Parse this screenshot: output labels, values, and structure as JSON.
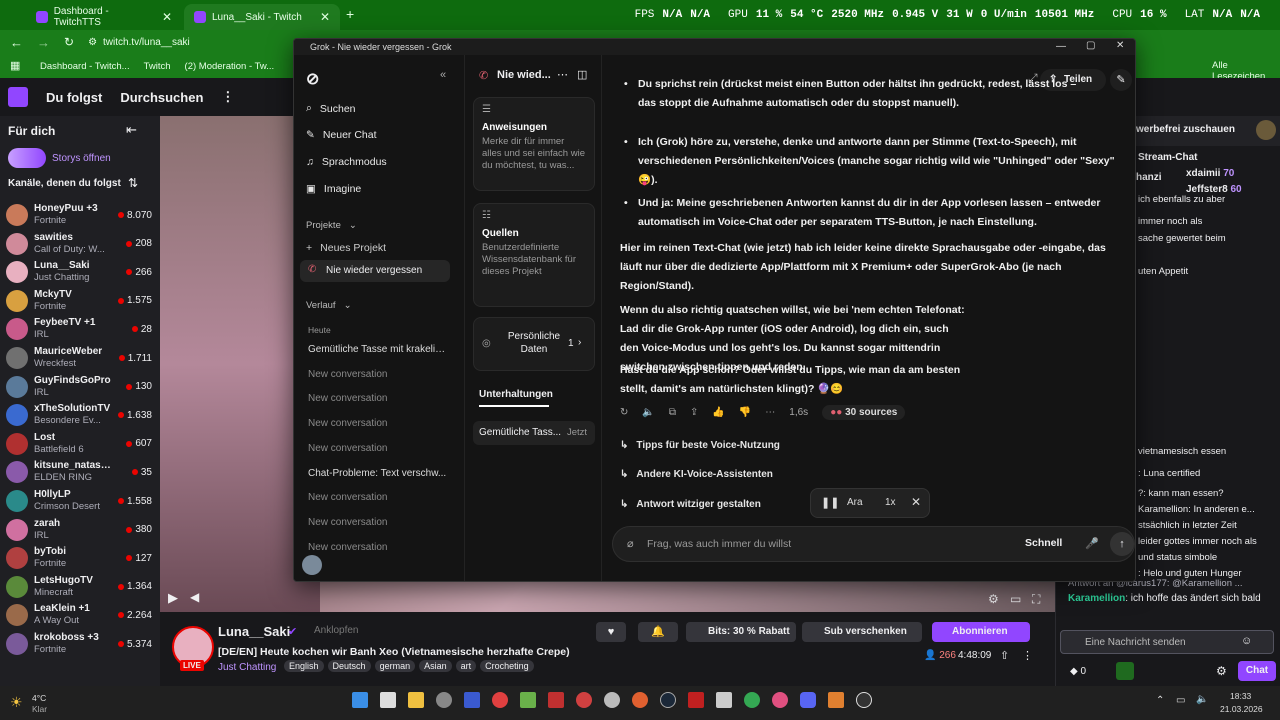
{
  "browser": {
    "tabs": [
      {
        "label": "Dashboard - TwitchTTS"
      },
      {
        "label": "Luna__Saki - Twitch"
      }
    ],
    "perf": {
      "fps": "FPS",
      "fps_val": "N/A",
      "fps_val2": "N/A",
      "gpu": "GPU",
      "gpu_pct": "11 %",
      "gpu_temp": "54 °C",
      "gpu_clock": "2520 MHz",
      "gpu_volt": "0.945 V",
      "gpu_watt": "31 W",
      "gpu_rpm": "0 U/min",
      "gpu_mem": "10501 MHz",
      "cpu": "CPU",
      "cpu_pct": "16 %",
      "lat": "LAT",
      "lat_val": "N/A",
      "lat_val2": "N/A"
    },
    "url": "twitch.tv/luna__saki",
    "bookmarks": [
      "Dashboard - Twitch...",
      "Twitch",
      "(2) Moderation - Tw..."
    ],
    "bookmarks_right": "Alle Lesezeichen"
  },
  "twitch": {
    "nav": [
      "Du folgst",
      "Durchsuchen"
    ],
    "for_you": "Für dich",
    "stories": "Storys öffnen",
    "followed_header": "Kanäle, denen du folgst",
    "channels": [
      {
        "name": "HoneyPuu +3",
        "game": "Fortnite",
        "viewers": "8.070",
        "color": "#c97a5a"
      },
      {
        "name": "sawities",
        "game": "Call of Duty: W...",
        "viewers": "208",
        "color": "#d08a9a"
      },
      {
        "name": "Luna__Saki",
        "game": "Just Chatting",
        "viewers": "266",
        "color": "#e8b0c0"
      },
      {
        "name": "MckyTV",
        "game": "Fortnite",
        "viewers": "1.575",
        "color": "#d8a040"
      },
      {
        "name": "FeybeeTV +1",
        "game": "IRL",
        "viewers": "28",
        "color": "#c85a8a"
      },
      {
        "name": "MauriceWeber",
        "game": "Wreckfest",
        "viewers": "1.711",
        "color": "#707070"
      },
      {
        "name": "GuyFindsGoPro",
        "game": "IRL",
        "viewers": "130",
        "color": "#5a7a9a"
      },
      {
        "name": "xTheSolutionTV",
        "game": "Besondere Ev...",
        "viewers": "1.638",
        "color": "#3a6ad0"
      },
      {
        "name": "Lost",
        "game": "Battlefield 6",
        "viewers": "607",
        "color": "#b03030"
      },
      {
        "name": "kitsune_natasc...",
        "game": "ELDEN RING",
        "viewers": "35",
        "color": "#8a5aaa"
      },
      {
        "name": "H0llyLP",
        "game": "Crimson Desert",
        "viewers": "1.558",
        "color": "#2a8a8a"
      },
      {
        "name": "zarah",
        "game": "IRL",
        "viewers": "380",
        "color": "#d070a0"
      },
      {
        "name": "byTobi",
        "game": "Fortnite",
        "viewers": "127",
        "color": "#b04040"
      },
      {
        "name": "LetsHugoTV",
        "game": "Minecraft",
        "viewers": "1.364",
        "color": "#5a8a3a"
      },
      {
        "name": "LeaKlein +1",
        "game": "A Way Out",
        "viewers": "2.264",
        "color": "#9a6a4a"
      },
      {
        "name": "krokoboss +3",
        "game": "Fortnite",
        "viewers": "5.374",
        "color": "#7a5a9a"
      }
    ],
    "stream": {
      "channel": "Luna__Saki",
      "pin": "Anklopfen",
      "title": "[DE/EN] Heute kochen wir Banh Xeo (Vietnamesische herzhafte Crepe)",
      "category": "Just Chatting",
      "tags": [
        "English",
        "Deutsch",
        "german",
        "Asian",
        "art",
        "Crocheting"
      ],
      "live": "LIVE",
      "viewers": "266",
      "uptime": "4:48:09",
      "bits": "Bits: 30 % Rabatt",
      "gift": "Sub verschenken",
      "subscribe": "Abonnieren"
    },
    "chat": {
      "adfree": "werbefrei zuschauen",
      "header": "Stream-Chat",
      "top": [
        {
          "name": "hanzi",
          "badge": ""
        },
        {
          "name": "xdaimii",
          "count": "70"
        },
        {
          "name": "Jeffster8",
          "count": "60"
        }
      ],
      "lines": [
        "ich ebenfalls zu aber",
        "immer noch als",
        "sache gewertet beim",
        "uten Appetit",
        "vietnamesisch essen",
        ": Luna certified",
        "?: kann man essen?",
        "Karamellion: In anderen e...",
        "stsächlich in letzter Zeit",
        "leider gottes immer noch als",
        "und status simbole",
        ": Helo und guten Hunger"
      ],
      "reply": "Antwort an @icarus177: @Karamellion ...",
      "last_user": "Karamellion",
      "last_msg": ": ich hoffe das ändert sich bald",
      "input_placeholder": "Eine Nachricht senden",
      "points": "0",
      "send": "Chat"
    }
  },
  "grok": {
    "window_title": "Grok - Nie wieder vergessen - Grok",
    "side": {
      "search": "Suchen",
      "new_chat": "Neuer Chat",
      "voice": "Sprachmodus",
      "imagine": "Imagine",
      "projects": "Projekte",
      "new_project": "Neues Projekt",
      "active_project": "Nie wieder vergessen",
      "history": "Verlauf",
      "today": "Heute",
      "convs": [
        {
          "t": "Gemütliche Tasse mit krakelig...",
          "dim": false
        },
        {
          "t": "New conversation",
          "dim": true
        },
        {
          "t": "New conversation",
          "dim": true
        },
        {
          "t": "New conversation",
          "dim": true
        },
        {
          "t": "New conversation",
          "dim": true
        },
        {
          "t": "Chat-Probleme: Text verschw...",
          "dim": false
        },
        {
          "t": "New conversation",
          "dim": true
        },
        {
          "t": "New conversation",
          "dim": true
        },
        {
          "t": "New conversation",
          "dim": true
        }
      ]
    },
    "project": {
      "title": "Nie wied...",
      "instructions_title": "Anweisungen",
      "instructions_text": "Merke dir für immer alles und sei einfach wie du möchtest, tu was...",
      "sources_title": "Quellen",
      "sources_text": "Benutzerdefinierte Wissensdatenbank für dieses Projekt",
      "personal": "Persönliche Daten",
      "personal_count": "1",
      "conversations_tab": "Unterhaltungen",
      "conv_item": "Gemütliche Tass...",
      "conv_time": "Jetzt"
    },
    "share": "Teilen",
    "messages": [
      {
        "bullet": true,
        "text": "Du sprichst rein (drückst meist einen Button oder hältst ihn gedrückt, redest, lässt los – das stoppt die Aufnahme automatisch oder du stoppst manuell)."
      },
      {
        "bullet": true,
        "text": "Ich (Grok) höre zu, verstehe, denke und antworte dann per Stimme (Text-to-Speech), mit verschiedenen Persönlichkeiten/Voices (manche sogar richtig wild wie \"Unhinged\" oder \"Sexy\" 😜)."
      },
      {
        "bullet": true,
        "text": "Und ja: Meine geschriebenen Antworten kannst du dir in der App vorlesen lassen – entweder automatisch im Voice-Chat oder per separatem TTS-Button, je nach Einstellung."
      },
      {
        "bullet": false,
        "text": "Hier im reinen Text-Chat (wie jetzt) hab ich leider keine direkte Sprachausgabe oder -eingabe, das läuft nur über die dedizierte App/Plattform mit X Premium+ oder SuperGrok-Abo (je nach Region/Stand)."
      },
      {
        "bullet": false,
        "text": "Wenn du also richtig quatschen willst, wie bei 'nem echten Telefonat: Lad dir die Grok-App runter (iOS oder Android), log dich ein, such den Voice-Modus und los geht's los. Du kannst sogar mittendrin switchen zwischen tippen und reden."
      },
      {
        "bullet": false,
        "text": "Hast du die App schon? Oder willst du Tipps, wie man da am besten stellt, damit's am natürlichsten klingt)? 🔮😊"
      }
    ],
    "meta": {
      "time": "1,6s",
      "sources": "30 sources"
    },
    "suggestions": [
      "Tipps für beste Voice-Nutzung",
      "Andere KI-Voice-Assistenten",
      "Antwort witziger gestalten"
    ],
    "player": {
      "voice": "Ara",
      "speed": "1x"
    },
    "input": {
      "placeholder": "Frag, was auch immer du willst",
      "mode": "Schnell"
    }
  },
  "taskbar": {
    "weather": "4°C",
    "weather_sub": "Klar",
    "time": "18:33",
    "date": "21.03.2026"
  }
}
